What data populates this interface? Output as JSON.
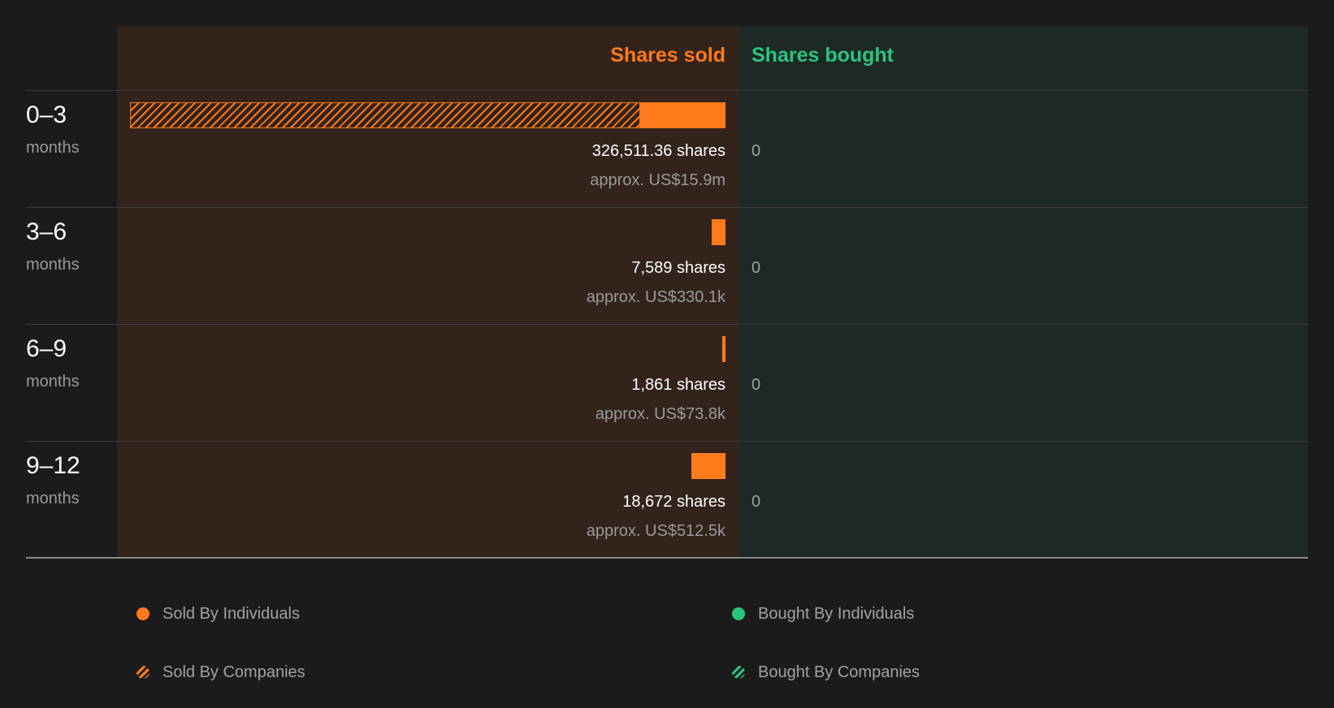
{
  "headers": {
    "sold": "Shares sold",
    "bought": "Shares bought"
  },
  "colors": {
    "sold": "#ff7a1a",
    "bought": "#2bc57d",
    "sold_bg": "#33231b",
    "bought_bg": "#1c2924",
    "page_bg": "#1b1b1b"
  },
  "chart_data": {
    "type": "bar",
    "orientation": "horizontal",
    "categories": [
      "0–3",
      "3–6",
      "6–9",
      "9–12"
    ],
    "category_unit": "months",
    "series": [
      {
        "name": "Sold By Individuals",
        "values": [
          47000,
          7589,
          1861,
          18672
        ]
      },
      {
        "name": "Sold By Companies",
        "values": [
          279511.36,
          0,
          0,
          0
        ]
      },
      {
        "name": "Bought By Individuals",
        "values": [
          0,
          0,
          0,
          0
        ]
      },
      {
        "name": "Bought By Companies",
        "values": [
          0,
          0,
          0,
          0
        ]
      }
    ],
    "rows": [
      {
        "range": "0–3",
        "unit": "months",
        "shares_label": "326,511.36 shares",
        "approx_label": "approx. US$15.9m",
        "bought_label": "0",
        "total_sold": 326511.36
      },
      {
        "range": "3–6",
        "unit": "months",
        "shares_label": "7,589 shares",
        "approx_label": "approx. US$330.1k",
        "bought_label": "0",
        "total_sold": 7589
      },
      {
        "range": "6–9",
        "unit": "months",
        "shares_label": "1,861 shares",
        "approx_label": "approx. US$73.8k",
        "bought_label": "0",
        "total_sold": 1861
      },
      {
        "range": "9–12",
        "unit": "months",
        "shares_label": "18,672 shares",
        "approx_label": "approx. US$512.5k",
        "bought_label": "0",
        "total_sold": 18672
      }
    ],
    "legend": [
      {
        "label": "Sold By Individuals",
        "icon": "solid-orange-dot-icon"
      },
      {
        "label": "Bought By Individuals",
        "icon": "solid-green-dot-icon"
      },
      {
        "label": "Sold By Companies",
        "icon": "hatched-orange-dot-icon"
      },
      {
        "label": "Bought By Companies",
        "icon": "hatched-green-dot-icon"
      }
    ]
  }
}
